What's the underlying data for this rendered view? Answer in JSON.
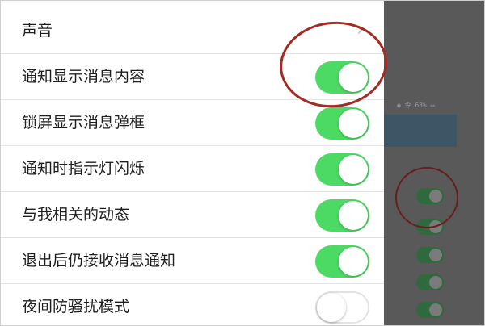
{
  "settings": {
    "rows": [
      {
        "label": "声音",
        "control": "chevron"
      },
      {
        "label": "通知显示消息内容",
        "control": "toggle",
        "on": true
      },
      {
        "label": "锁屏显示消息弹框",
        "control": "toggle",
        "on": true
      },
      {
        "label": "通知时指示灯闪烁",
        "control": "toggle",
        "on": true
      },
      {
        "label": "与我相关的动态",
        "control": "toggle",
        "on": true
      },
      {
        "label": "退出后仍接收消息通知",
        "control": "toggle",
        "on": true
      },
      {
        "label": "夜间防骚扰模式",
        "control": "toggle",
        "on": false
      }
    ]
  },
  "background_screen": {
    "status_text": "◉ 令 63% ▭"
  },
  "colors": {
    "toggle_on": "#4cd964",
    "toggle_off_border": "#e3e3e3",
    "annotation": "#a52a22",
    "overlay": "#595959"
  },
  "icons": {
    "row0_control": "chevron-right-icon"
  }
}
